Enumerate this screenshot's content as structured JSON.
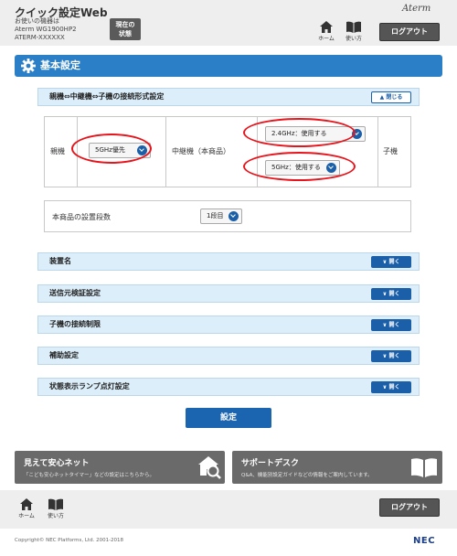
{
  "header": {
    "app_title": "クイック設定Web",
    "device_line1": "お使いの機器は",
    "device_line2": "Aterm WG1900HP2",
    "device_line3": "ATERM-XXXXXX",
    "status_line1": "現在の",
    "status_line2": "状態",
    "brand": "Aterm",
    "home_label": "ホーム",
    "help_label": "使い方",
    "logout_label": "ログアウト"
  },
  "section": {
    "title": "基本設定"
  },
  "connection": {
    "title": "親機⇔中継機⇔子機の接続形式設定",
    "close_label": "閉じる",
    "parent_label": "親機",
    "parent_select": "5GHz優先",
    "repeater_label": "中継機（本商品）",
    "repeater_24_select": "2.4GHz：使用する",
    "repeater_5_select": "5GHz：使用する",
    "child_label": "子機"
  },
  "stage": {
    "label": "本商品の設置段数",
    "value": "1段目"
  },
  "panels": [
    {
      "title": "装置名",
      "open_label": "開く"
    },
    {
      "title": "送信元検証設定",
      "open_label": "開く"
    },
    {
      "title": "子機の接続制限",
      "open_label": "開く"
    },
    {
      "title": "補助設定",
      "open_label": "開く"
    },
    {
      "title": "状態表示ランプ点灯設定",
      "open_label": "開く"
    }
  ],
  "submit_label": "設定",
  "promo": {
    "left_title": "見えて安心ネット",
    "left_desc": "「こども安心ネットタイマー」などの設定はこちらから。",
    "right_title": "サポートデスク",
    "right_desc": "Q&A、機能別設定ガイドなどの情報をご案内しています。"
  },
  "footer": {
    "home_label": "ホーム",
    "help_label": "使い方",
    "logout_label": "ログアウト",
    "copyright": "Copyright© NEC Platforms, Ltd. 2001-2018",
    "brand": "NEC"
  },
  "colors": {
    "accent": "#2a7fc6",
    "button": "#1a64b0",
    "highlight": "#e8141c",
    "panel": "#dceefa"
  }
}
